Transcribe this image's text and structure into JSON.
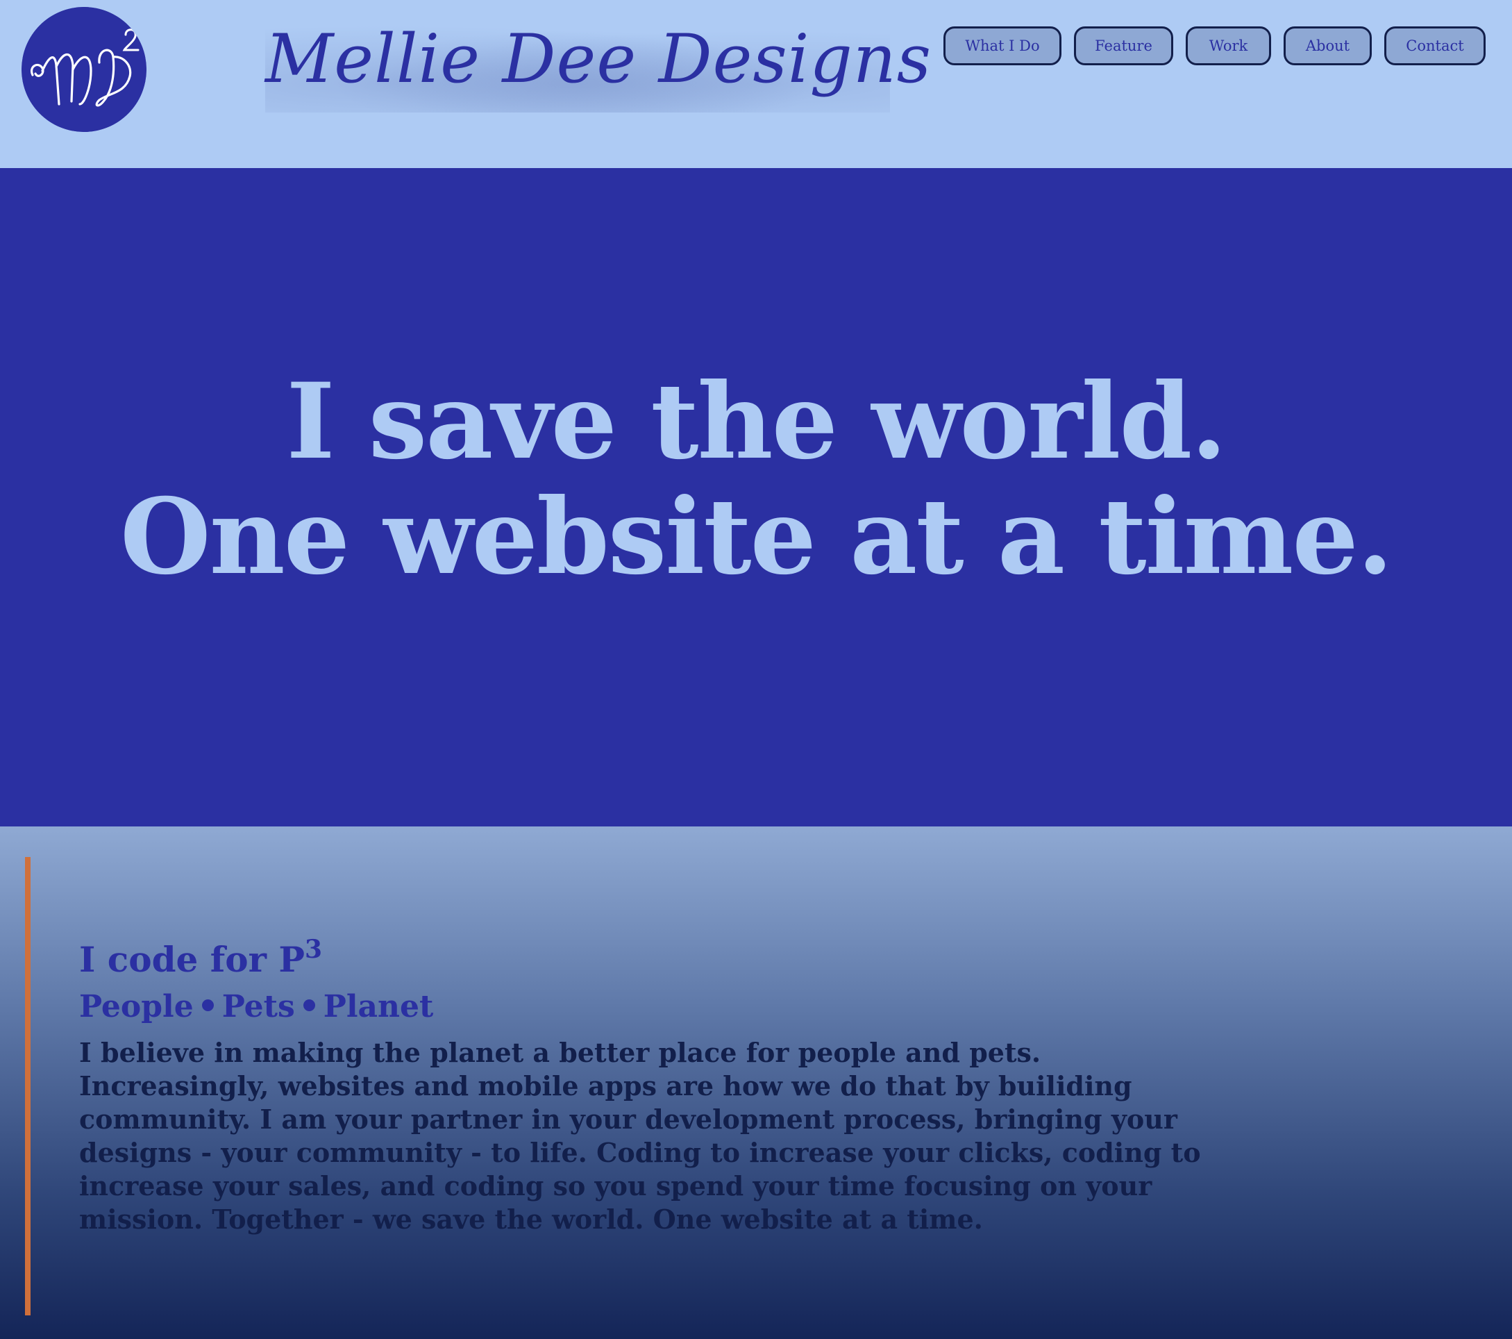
{
  "header": {
    "logo_monogram": "MD²",
    "wordmark": "Mellie Dee Designs",
    "nav": [
      {
        "label": "What I Do"
      },
      {
        "label": "Feature"
      },
      {
        "label": "Work"
      },
      {
        "label": "About"
      },
      {
        "label": "Contact"
      }
    ]
  },
  "hero": {
    "line1": "I save the world.",
    "line2": "One website at a time."
  },
  "mission": {
    "title": "I code for P",
    "title_sup": "3",
    "pillars": [
      "People",
      "Pets",
      "Planet"
    ],
    "body": "I believe in making the planet a better place for people and pets. Increasingly, websites and mobile apps are how we do that by builiding community. I am your partner in your development process, bringing your designs - your community - to life. Coding to increase your clicks, coding to increase your sales, and coding so you spend your time focusing on your mission. Together - we save the world. One website at a time."
  },
  "colors": {
    "brand_dark_blue": "#2b30a2",
    "light_blue": "#aecbf4",
    "navy": "#121f4b",
    "accent_orange": "#d0703b"
  }
}
